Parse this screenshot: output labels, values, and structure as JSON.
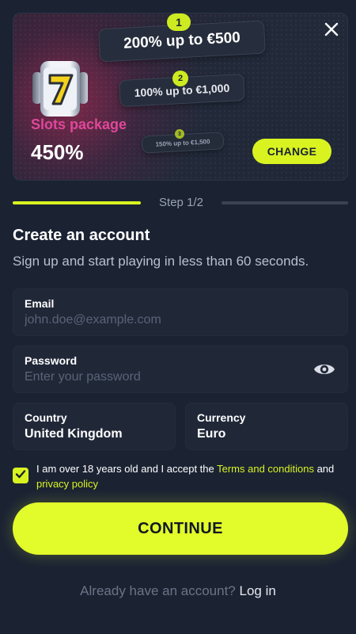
{
  "banner": {
    "tiers": [
      {
        "number": "1",
        "text": "200% up to €500"
      },
      {
        "number": "2",
        "text": "100% up to €1,000"
      },
      {
        "number": "3",
        "text": "150% up to €1,500"
      }
    ],
    "package_name": "Slots package",
    "package_percent": "450%",
    "change_label": "CHANGE",
    "close_icon": "close-icon",
    "slot_icon": "slot-machine-seven-icon"
  },
  "steps": {
    "label": "Step 1/2",
    "current": 1,
    "total": 2
  },
  "form": {
    "title": "Create an account",
    "subtitle": "Sign up and start playing in less than 60 seconds.",
    "email": {
      "label": "Email",
      "placeholder": "john.doe@example.com",
      "value": ""
    },
    "password": {
      "label": "Password",
      "placeholder": "Enter your password",
      "value": "",
      "toggle_icon": "eye-icon"
    },
    "country": {
      "label": "Country",
      "value": "United Kingdom"
    },
    "currency": {
      "label": "Currency",
      "value": "Euro"
    },
    "terms": {
      "checked": true,
      "text_before": "I am over 18 years old and I accept the ",
      "terms_link": "Terms and conditions",
      "text_middle": " and ",
      "privacy_link": "privacy policy"
    },
    "continue_label": "CONTINUE"
  },
  "login": {
    "prompt": "Already have an account?",
    "link": "Log in"
  },
  "colors": {
    "background": "#1b2333",
    "accent": "#d9f321",
    "package_pink": "#e0479a",
    "field_bg": "#202838"
  }
}
